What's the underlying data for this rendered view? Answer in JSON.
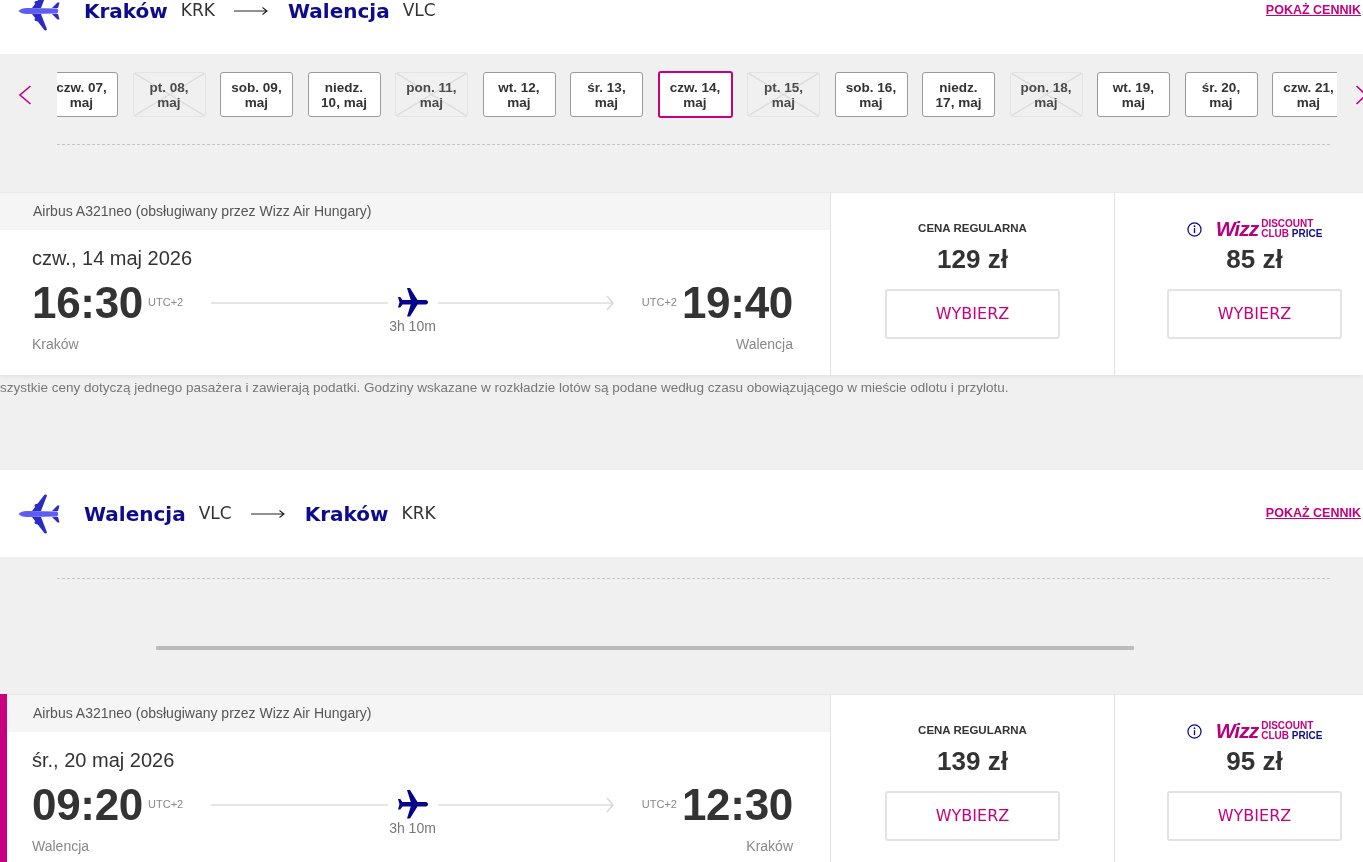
{
  "legs": [
    {
      "origin": {
        "city": "Kraków",
        "code": "KRK"
      },
      "destination": {
        "city": "Walencja",
        "code": "VLC"
      },
      "price_link": "POKAŻ CENNIK",
      "dates": [
        {
          "lines": [
            "czw. 07,",
            "maj"
          ],
          "selected": false,
          "disabled": false
        },
        {
          "lines": [
            "pt. 08,",
            "maj"
          ],
          "selected": false,
          "disabled": true
        },
        {
          "lines": [
            "sob. 09,",
            "maj"
          ],
          "selected": false,
          "disabled": false
        },
        {
          "lines": [
            "niedz.",
            "10, maj"
          ],
          "selected": false,
          "disabled": false
        },
        {
          "lines": [
            "pon. 11,",
            "maj"
          ],
          "selected": false,
          "disabled": true
        },
        {
          "lines": [
            "wt. 12,",
            "maj"
          ],
          "selected": false,
          "disabled": false
        },
        {
          "lines": [
            "śr. 13,",
            "maj"
          ],
          "selected": false,
          "disabled": false
        },
        {
          "lines": [
            "czw. 14,",
            "maj"
          ],
          "selected": true,
          "disabled": false
        },
        {
          "lines": [
            "pt. 15,",
            "maj"
          ],
          "selected": false,
          "disabled": true
        },
        {
          "lines": [
            "sob. 16,",
            "maj"
          ],
          "selected": false,
          "disabled": false
        },
        {
          "lines": [
            "niedz.",
            "17, maj"
          ],
          "selected": false,
          "disabled": false
        },
        {
          "lines": [
            "pon. 18,",
            "maj"
          ],
          "selected": false,
          "disabled": true
        },
        {
          "lines": [
            "wt. 19,",
            "maj"
          ],
          "selected": false,
          "disabled": false
        },
        {
          "lines": [
            "śr. 20,",
            "maj"
          ],
          "selected": false,
          "disabled": false
        },
        {
          "lines": [
            "czw. 21,",
            "maj"
          ],
          "selected": false,
          "disabled": false
        }
      ],
      "flights": [
        {
          "selected": false,
          "aircraft": "Airbus A321neo (obsługiwany przez Wizz Air Hungary)",
          "date": "czw., 14 maj 2026",
          "departure": {
            "time": "16:30",
            "timezone": "UTC+2",
            "city": "Kraków"
          },
          "arrival": {
            "time": "19:40",
            "timezone": "UTC+2",
            "city": "Walencja"
          },
          "duration": "3h 10m",
          "fares": [
            {
              "kind": "regular",
              "label": "CENA REGULARNA",
              "price": "129 zł",
              "button": "WYBIERZ"
            },
            {
              "kind": "club",
              "logo": {
                "brand": "Wizz",
                "top": "DISCOUNT",
                "bottom_left": "CLUB",
                "bottom_right": "PRICE"
              },
              "price": "85 zł",
              "button": "WYBIERZ"
            }
          ]
        }
      ],
      "note": "szystkie ceny dotyczą jednego pasażera i zawierają podatki. Godziny wskazane w rozkładzie lotów są podane według czasu obowiązującego w mieście odlotu i przylotu."
    },
    {
      "origin": {
        "city": "Walencja",
        "code": "VLC"
      },
      "destination": {
        "city": "Kraków",
        "code": "KRK"
      },
      "price_link": "POKAŻ CENNIK",
      "flights": [
        {
          "selected": true,
          "aircraft": "Airbus A321neo (obsługiwany przez Wizz Air Hungary)",
          "date": "śr., 20 maj 2026",
          "departure": {
            "time": "09:20",
            "timezone": "UTC+2",
            "city": "Walencja"
          },
          "arrival": {
            "time": "12:30",
            "timezone": "UTC+2",
            "city": "Kraków"
          },
          "duration": "3h 10m",
          "fares": [
            {
              "kind": "regular",
              "label": "CENA REGULARNA",
              "price": "139 zł",
              "button": "WYBIERZ"
            },
            {
              "kind": "club",
              "logo": {
                "brand": "Wizz",
                "top": "DISCOUNT",
                "bottom_left": "CLUB",
                "bottom_right": "PRICE"
              },
              "price": "95 zł",
              "button": "WYBIERZ"
            }
          ]
        }
      ]
    }
  ]
}
